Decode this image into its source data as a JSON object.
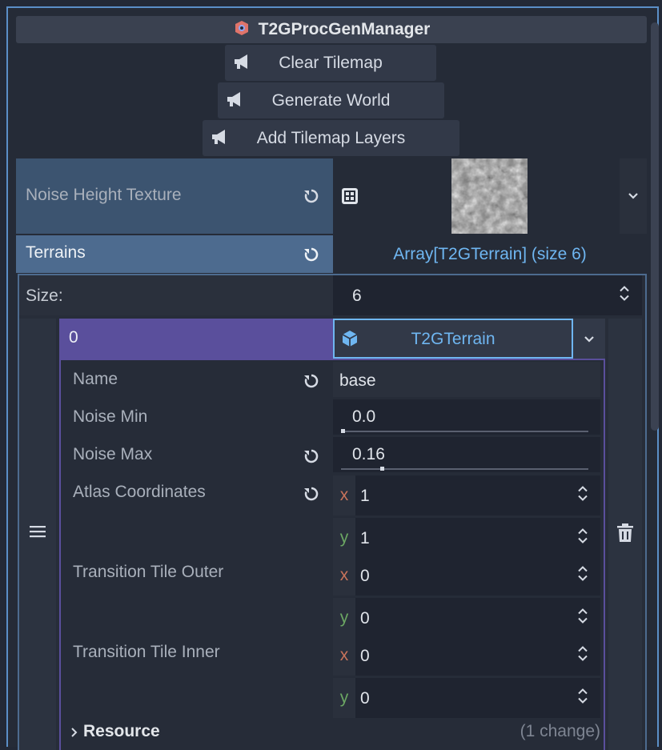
{
  "header": {
    "title": "T2GProcGenManager"
  },
  "buttons": {
    "clear_tilemap": "Clear Tilemap",
    "generate_world": "Generate World",
    "add_tilemap_layers": "Add Tilemap Layers"
  },
  "noise_height_texture": {
    "label": "Noise Height Texture"
  },
  "terrains": {
    "label": "Terrains",
    "value": "Array[T2GTerrain] (size 6)",
    "size_label": "Size:",
    "size_value": "6"
  },
  "element": {
    "index": "0",
    "type_name": "T2GTerrain",
    "name_label": "Name",
    "name_value": "base",
    "noise_min_label": "Noise Min",
    "noise_min_value": "0.0",
    "noise_min_fraction": 0.0,
    "noise_max_label": "Noise Max",
    "noise_max_value": "0.16",
    "noise_max_fraction": 0.16,
    "atlas_label": "Atlas Coordinates",
    "atlas_x": "1",
    "atlas_y": "1",
    "outer_label": "Transition Tile Outer",
    "outer_x": "0",
    "outer_y": "0",
    "inner_label": "Transition Tile Inner",
    "inner_x": "0",
    "inner_y": "0",
    "resource_label": "Resource",
    "resource_changes": "(1 change)"
  },
  "axis_labels": {
    "x": "x",
    "y": "y"
  },
  "colors": {
    "accent_blue": "#5b8fc7",
    "element_purple": "#5a4f9c",
    "array_link": "#6fb6f1"
  },
  "icons": [
    "godot-node-icon",
    "megaphone-icon",
    "reset-icon",
    "texture-icon",
    "chevron-down-icon",
    "spinner-icon",
    "resource-cube-icon",
    "drag-handle-icon",
    "trash-icon",
    "chevron-right-icon"
  ]
}
